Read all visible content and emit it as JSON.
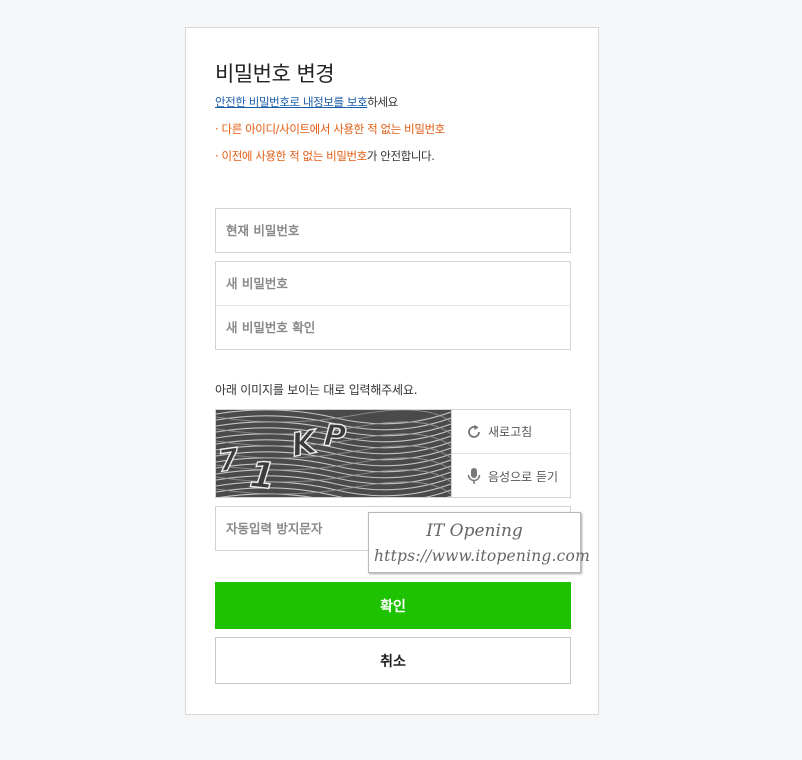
{
  "form": {
    "title": "비밀번호 변경",
    "desc_link": "안전한 비밀번호로 내정보를 보호",
    "desc_tail": "하세요",
    "rule1": "· 다른 아이디/사이트에서 사용한 적 없는 비밀번호",
    "rule2_warn": "· 이전에 사용한 적 없는 비밀번호",
    "rule2_tail": "가 안전합니다."
  },
  "fields": {
    "current_pw_placeholder": "현재 비밀번호",
    "new_pw_placeholder": "새 비밀번호",
    "confirm_pw_placeholder": "새 비밀번호 확인"
  },
  "captcha": {
    "guide": "아래 이미지를 보이는 대로 입력해주세요.",
    "image_text": "71KP",
    "refresh_label": "새로고침",
    "audio_label": "음성으로 듣기",
    "input_placeholder": "자동입력 방지문자"
  },
  "buttons": {
    "confirm_label": "확인",
    "cancel_label": "취소"
  },
  "watermark": {
    "title": "IT Opening",
    "url": "https://www.itopening.com"
  },
  "colors": {
    "primary_green": "#1ec200",
    "warning_orange": "#e25c12",
    "link_blue": "#1b5ca8"
  }
}
